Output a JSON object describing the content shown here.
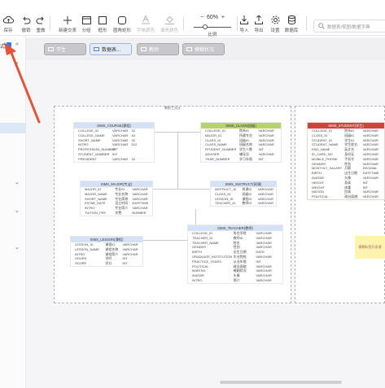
{
  "toolbar": {
    "save": "保存",
    "undo": "撤销",
    "redo": "重做",
    "new_subject": "新建交表",
    "group": "分组",
    "frame": "框形",
    "rounded_rect": "圆角矩形",
    "font_color": "字体颜色",
    "fill_color": "填充颜色",
    "zoom_value": "60%",
    "zoom_label": "比例",
    "import": "导入",
    "export": "导出",
    "settings": "设置",
    "database": "数据库",
    "search_placeholder": "数据表/视图/数据字典"
  },
  "tabs": [
    {
      "label": "学生"
    },
    {
      "label": "数据表..."
    },
    {
      "label": "教师"
    },
    {
      "label": "模糊状况"
    }
  ],
  "sidebar": {
    "top_label": "式"
  },
  "diagram": {
    "caption": "教职工设计"
  },
  "note": {
    "text": "模糊标签开发通"
  },
  "entities": {
    "course": {
      "title": "SIMS_COURSE(课程)",
      "rows": [
        [
          "COLLEGE_ID",
          "VARCHAR",
          "32"
        ],
        [
          "COLLEGE_NAME",
          "VARCHAR",
          "64"
        ],
        [
          "SHORT_NAME",
          "VARCHAR",
          "32"
        ],
        [
          "INTRO",
          "VARCHAR",
          "512"
        ],
        [
          "PROFESSION_NUMBER",
          "INT",
          ""
        ],
        [
          "STUDENT_NUMBER",
          "INT",
          ""
        ],
        [
          "PRESIDENT",
          "VARCHAR",
          "32"
        ]
      ]
    },
    "major": {
      "title": "SIMS_MAJOR(专业)",
      "rows": [
        [
          "MAJOR_ID",
          "专业ID",
          "VARCHAR"
        ],
        [
          "MAJOR_NAME",
          "专业名称",
          "VARCHAR"
        ],
        [
          "SHORT_NAME",
          "专业简称",
          "VARCHAR"
        ],
        [
          "ESTAB_DATE",
          "设立时间",
          "DATETIME"
        ],
        [
          "INTRO",
          "专业简介",
          "VARCHAR"
        ],
        [
          "TUITION_FEE",
          "学费",
          "NUMBER"
        ]
      ]
    },
    "lesson": {
      "title": "SIMS_LESSON(课程)",
      "rows": [
        [
          "LESSON_ID",
          "课程ID",
          "VARCHAR"
        ],
        [
          "LESSON_NAME",
          "课程名称",
          "VARCHAR"
        ],
        [
          "INTRO",
          "课程简介",
          "VARCHAR"
        ],
        [
          "HOURS",
          "学时",
          "INT"
        ],
        [
          "SCORE",
          "学分",
          "INT"
        ]
      ]
    },
    "class": {
      "title": "SIMS_CLASS(班级)",
      "rows": [
        [
          "COLLEGE_ID",
          "院系ID",
          "VARCHAR"
        ],
        [
          "MAJOR_ID",
          "所属专业",
          "VARCHAR"
        ],
        [
          "CLASS_ID",
          "班级ID",
          "VARCHAR"
        ],
        [
          "CLASS_NAME",
          "班级名称",
          "VARCHAR"
        ],
        [
          "STUDENT_NUMBER",
          "学生人数",
          "INT"
        ],
        [
          "ADVISER",
          "辅导员",
          "VARCHAR"
        ],
        [
          "YEAR_NUMBER",
          "学习年限",
          "INT"
        ]
      ]
    },
    "instruct": {
      "title": "SIMS_INSTRUCT(授课)",
      "rows": [
        [
          "INSTRUCT_ID",
          "授课ID",
          "VARCHAR"
        ],
        [
          "CLASS_ID",
          "班级ID",
          "VARCHAR"
        ],
        [
          "LESSON_ID",
          "课程ID",
          "VARCHAR"
        ],
        [
          "TEACHER_ID",
          "教师ID",
          "VARCHAR"
        ]
      ]
    },
    "teacher": {
      "title": "SIMS_TEACHER(教师)",
      "rows": [
        [
          "COLLEGE_ID",
          "所在学院",
          "VARCHAR"
        ],
        [
          "TEACHER_ID",
          "教师ID",
          "VARCHAR"
        ],
        [
          "TEACHER_NAME",
          "姓名",
          "VARCHAR"
        ],
        [
          "GENDER",
          "性别",
          "VARCHAR"
        ],
        [
          "BIRTH",
          "出生日期",
          "DATE"
        ],
        [
          "GRADUATE_INSTITUTION",
          "毕业院校",
          "VARCHAR"
        ],
        [
          "PRACTICE_YEARS",
          "从业年限",
          "INT"
        ],
        [
          "POLITICAL",
          "政治面貌",
          "VARCHAR"
        ],
        [
          "MARITAL",
          "婚姻状况",
          "VARCHAR"
        ],
        [
          "AVATAR",
          "头像",
          "VARCHAR"
        ],
        [
          "INTRO",
          "简介",
          "VARCHAR"
        ]
      ]
    },
    "student": {
      "title": "SIMS_STUDENT(学生)",
      "rows": [
        [
          "COLLEGE_ID",
          "院系ID",
          "VARCHAR"
        ],
        [
          "CLASS_ID",
          "班级ID",
          "VARCHAR"
        ],
        [
          "STUDENT_ID",
          "学生ID",
          "VARCHAR"
        ],
        [
          "STUDENT_NAME",
          "学生姓名",
          "VARCHAR"
        ],
        [
          "ENG_NAME",
          "英文名",
          "VARCHAR"
        ],
        [
          "ID_CARD_NO",
          "身份证",
          "VARCHAR"
        ],
        [
          "MOBILE_PHONE",
          "手机号",
          "VARCHAR"
        ],
        [
          "GENDER",
          "性别",
          "VARCHAR"
        ],
        [
          "MONTHLY_SALARY",
          "月薪",
          "DECIMAL"
        ],
        [
          "BIRTH",
          "出生日期",
          "DATETIME"
        ],
        [
          "AVATAR",
          "头像",
          "VARCHAR"
        ],
        [
          "HEIGHT",
          "身高",
          "INT"
        ],
        [
          "WEIGHT",
          "体重",
          "INT"
        ],
        [
          "NATION",
          "民族",
          "VARCHAR"
        ],
        [
          "POLITICAL",
          "政治面貌",
          "VARCHAR"
        ]
      ]
    }
  },
  "colors": {
    "accent": "#2d7ff9",
    "arrow": "#e2553a",
    "entity_header": "#d5e2f4",
    "class_header": "#b8d36b",
    "student_header": "#c9463c"
  }
}
